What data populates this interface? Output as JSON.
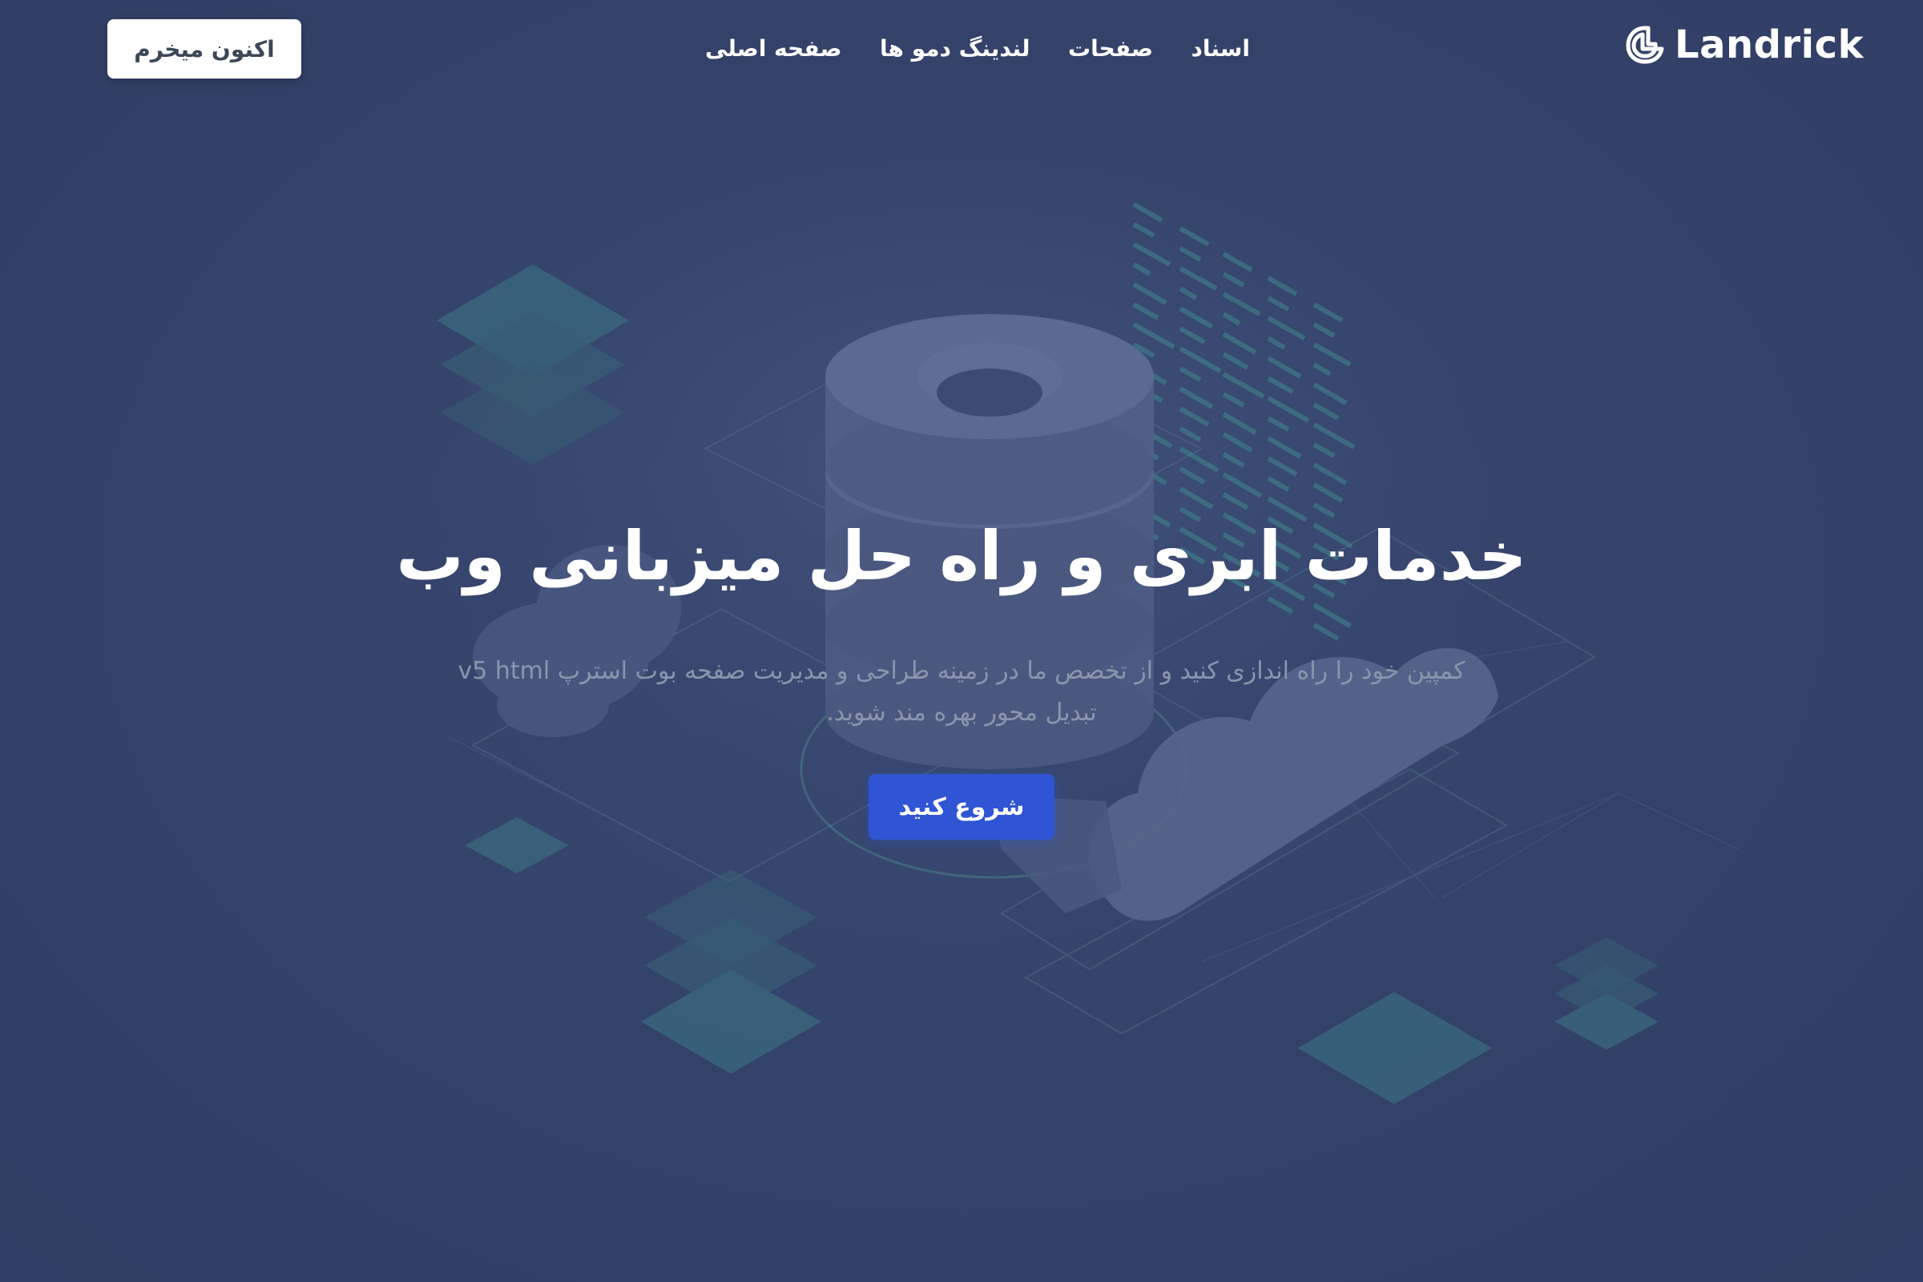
{
  "brand": {
    "name": "Landrick",
    "logo_icon": "landrick-logo-icon"
  },
  "nav": {
    "items": [
      {
        "label": "صفحه اصلی"
      },
      {
        "label": "لندینگ دمو ها"
      },
      {
        "label": "صفحات"
      },
      {
        "label": "اسناد"
      }
    ]
  },
  "header": {
    "buy_label": "اکنون میخرم"
  },
  "hero": {
    "title": "خدمات ابری و راه حل میزبانی وب",
    "subtitle": "کمپین خود را راه اندازی کنید و از تخصص ما در زمینه طراحی و مدیریت صفحه بوت استرپ v5 html تبدیل محور بهره مند شوید.",
    "cta_label": "شروع کنید",
    "illustration": "cloud-server-isometric-illustration"
  },
  "colors": {
    "background": "#35446a",
    "primary": "#2f55d4",
    "accent_teal": "#3f7f8a",
    "text_muted": "#8b95ad",
    "white": "#ffffff"
  }
}
